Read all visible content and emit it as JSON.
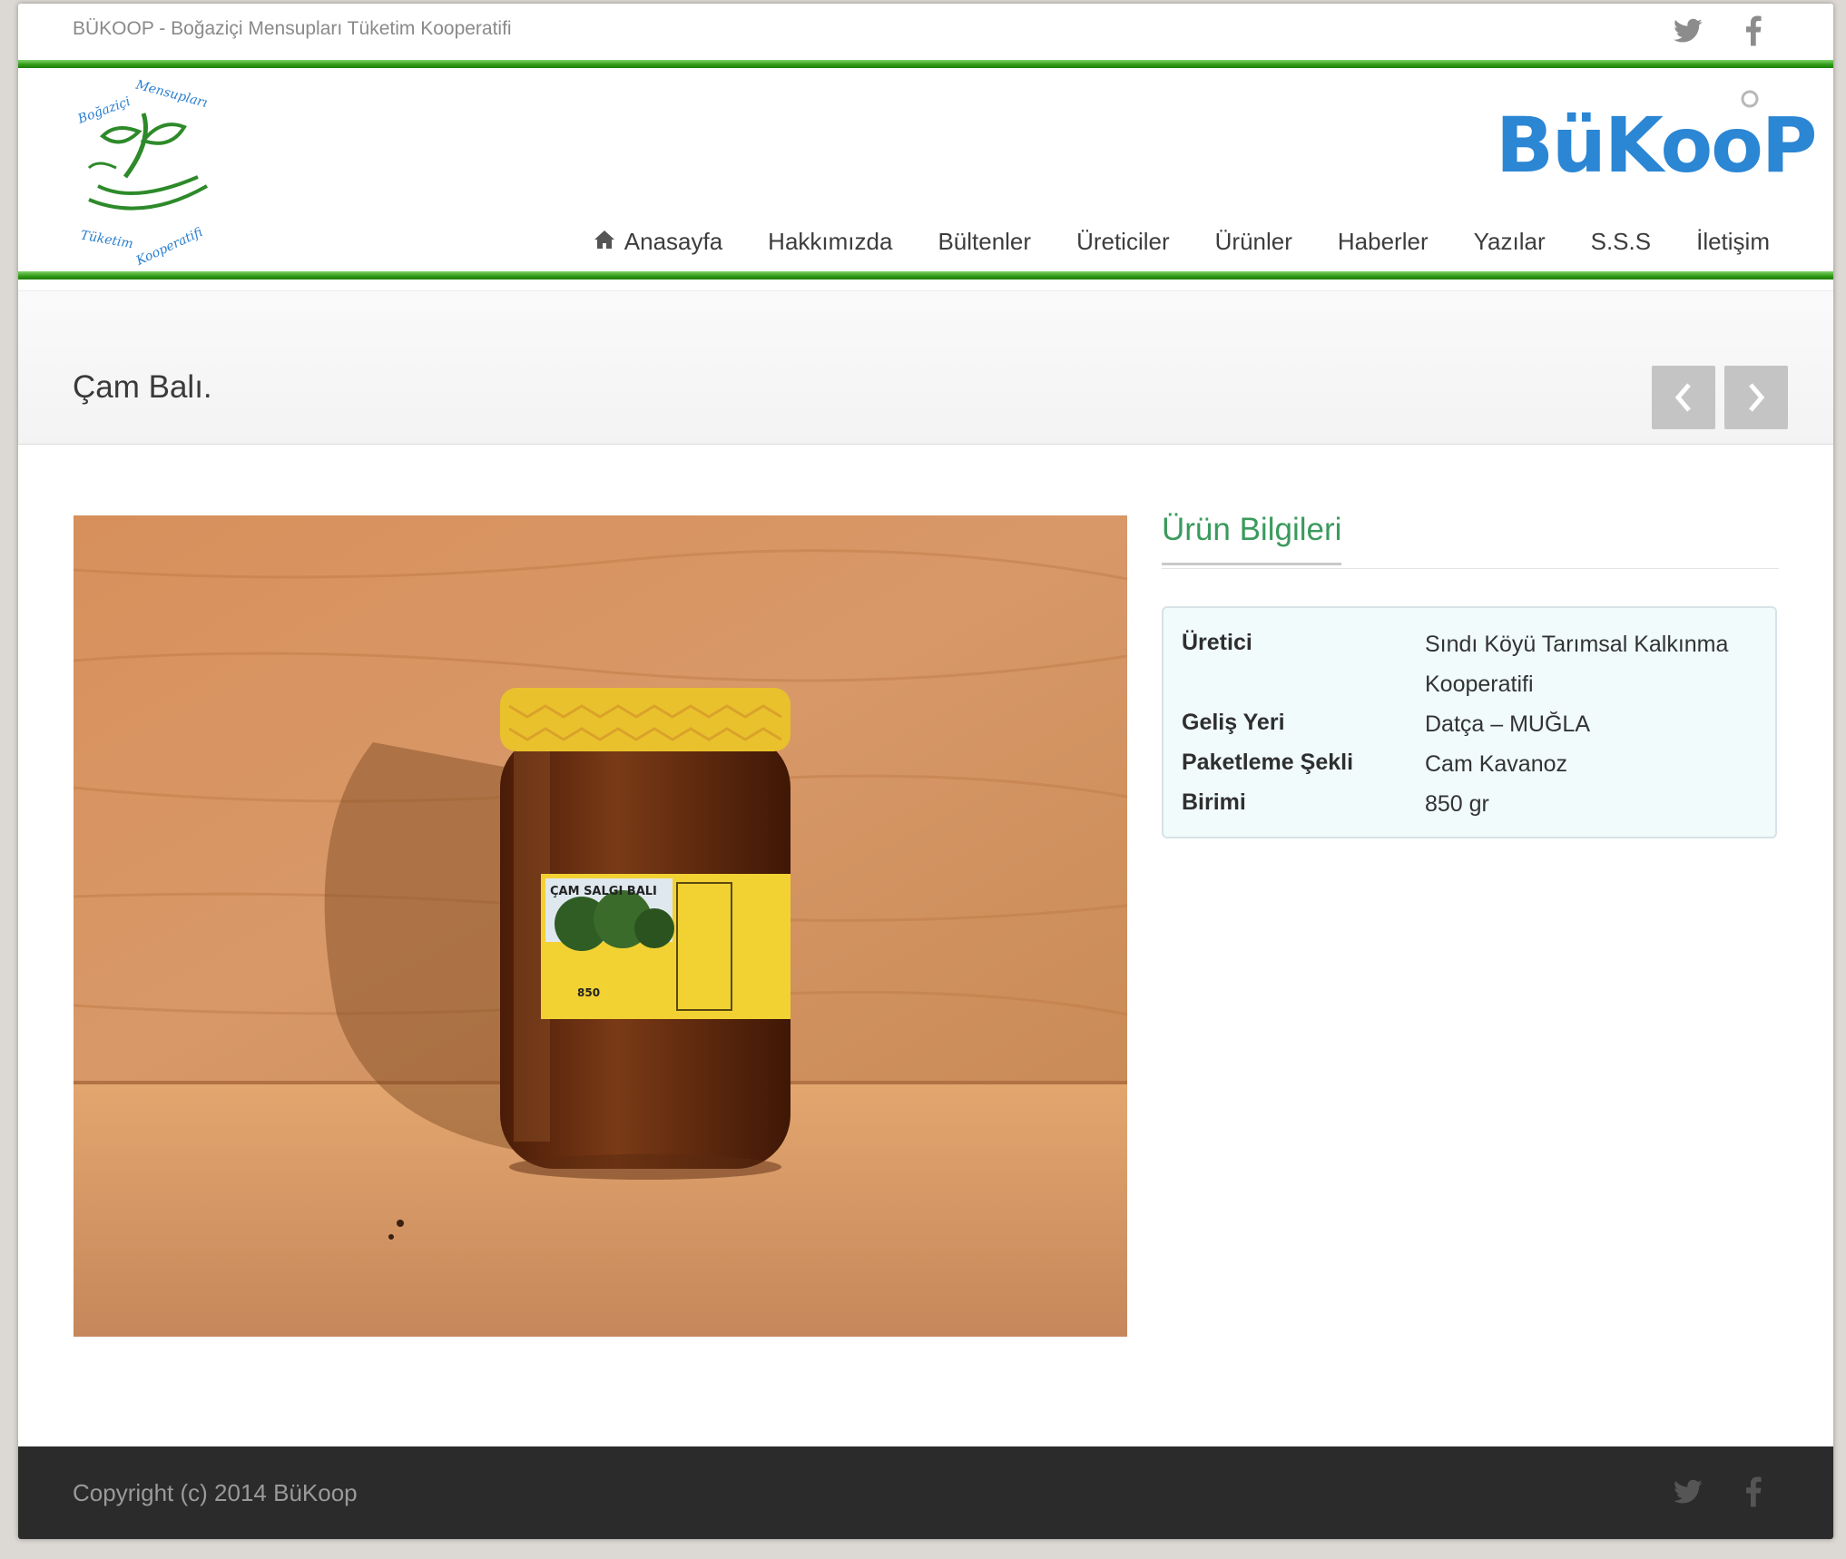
{
  "topbar": {
    "tagline": "BÜKOOP - Boğaziçi Mensupları Tüketim Kooperatifi",
    "social": [
      "twitter-icon",
      "facebook-icon"
    ]
  },
  "header": {
    "brand": "BüKooP",
    "nav": [
      {
        "label": "Anasayfa",
        "icon": "home-icon"
      },
      {
        "label": "Hakkımızda"
      },
      {
        "label": "Bültenler"
      },
      {
        "label": "Üreticiler"
      },
      {
        "label": "Ürünler"
      },
      {
        "label": "Haberler"
      },
      {
        "label": "Yazılar"
      },
      {
        "label": "S.S.S"
      },
      {
        "label": "İletişim"
      }
    ]
  },
  "page": {
    "title": "Çam Balı."
  },
  "product": {
    "info_title": "Ürün Bilgileri",
    "rows": [
      {
        "key": "Üretici",
        "value": "Sındı Köyü Tarımsal Kalkınma Kooperatifi"
      },
      {
        "key": "Geliş Yeri",
        "value": "Datça – MUĞLA"
      },
      {
        "key": "Paketleme Şekli",
        "value": "Cam Kavanoz"
      },
      {
        "key": "Birimi",
        "value": "850 gr"
      }
    ],
    "label_text": "ÇAM SALGI BALI",
    "label_weight": "850"
  },
  "footer": {
    "copyright": "Copyright (c) 2014 BüKoop"
  },
  "colors": {
    "accent_green": "#3a9a5c",
    "brand_blue": "#2b86d4",
    "footer_bg": "#2b2b2b"
  }
}
